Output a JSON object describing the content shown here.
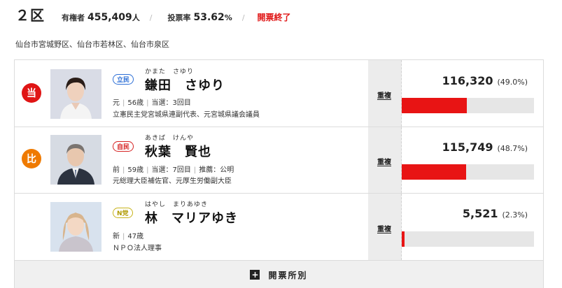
{
  "header": {
    "district": "２区",
    "voters_label": "有権者",
    "voters_value": "455,409",
    "voters_unit": "人",
    "sep": "/",
    "turnout_label": "投票率",
    "turnout_value": "53.62",
    "turnout_unit": "%",
    "status": "開票終了"
  },
  "area": "仙台市宮城野区、仙台市若林区、仙台市泉区",
  "candidates": [
    {
      "badge": "当",
      "party": "立民",
      "furigana": "かまた　さゆり",
      "name": "鎌田　さゆり",
      "meta": [
        "元",
        "56歳",
        "当選：3回目"
      ],
      "career": "立憲民主党宮城県連副代表、元宮城県議会議員",
      "duplicate": "重複",
      "votes": "116,320",
      "pct": "(49.0%)",
      "share": 0.49
    },
    {
      "badge": "比",
      "party": "自民",
      "furigana": "あきば　けんや",
      "name": "秋葉　賢也",
      "meta": [
        "前",
        "59歳",
        "当選：7回目",
        "推薦：公明"
      ],
      "career": "元総理大臣補佐官、元厚生労働副大臣",
      "duplicate": "重複",
      "votes": "115,749",
      "pct": "(48.7%)",
      "share": 0.487
    },
    {
      "badge": "",
      "party": "N党",
      "furigana": "はやし　まりあゆき",
      "name": "林　マリアゆき",
      "meta": [
        "新",
        "47歳"
      ],
      "career": "ＮＰＯ法人理事",
      "duplicate": "重複",
      "votes": "5,521",
      "pct": "(2.3%)",
      "share": 0.023
    }
  ],
  "footer": {
    "icon": "plus-icon",
    "label": "開票所別"
  },
  "colors": {
    "win_badge": "#e01515",
    "pr_badge": "#ef7a00",
    "bar": "#e81414",
    "status": "#e01515"
  }
}
